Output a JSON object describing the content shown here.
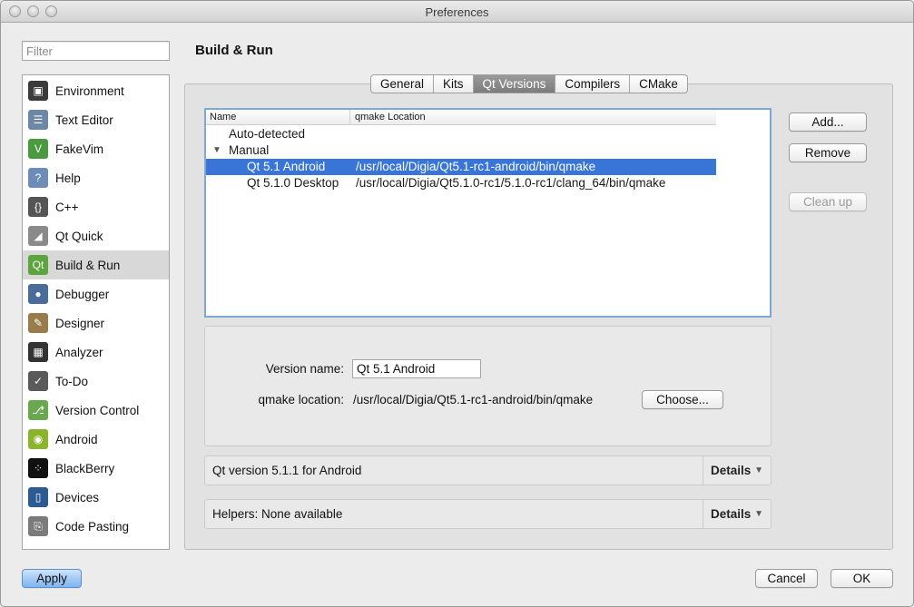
{
  "window": {
    "title": "Preferences"
  },
  "filter": {
    "placeholder": "Filter"
  },
  "sidebar": {
    "items": [
      {
        "label": "Environment",
        "icon": "environment-icon",
        "color": "#3b3b3b"
      },
      {
        "label": "Text Editor",
        "icon": "text-editor-icon",
        "color": "#6d87a6"
      },
      {
        "label": "FakeVim",
        "icon": "fakevim-icon",
        "color": "#4a9a3f"
      },
      {
        "label": "Help",
        "icon": "help-icon",
        "color": "#6e8cb8"
      },
      {
        "label": "C++",
        "icon": "cpp-icon",
        "color": "#555555"
      },
      {
        "label": "Qt Quick",
        "icon": "qt-quick-icon",
        "color": "#8a8a8a"
      },
      {
        "label": "Build & Run",
        "icon": "build-run-icon",
        "color": "#5aa53c"
      },
      {
        "label": "Debugger",
        "icon": "debugger-icon",
        "color": "#4a6c9a"
      },
      {
        "label": "Designer",
        "icon": "designer-icon",
        "color": "#9a7b4a"
      },
      {
        "label": "Analyzer",
        "icon": "analyzer-icon",
        "color": "#333333"
      },
      {
        "label": "To-Do",
        "icon": "todo-icon",
        "color": "#5a5a5a"
      },
      {
        "label": "Version Control",
        "icon": "version-control-icon",
        "color": "#6aa84f"
      },
      {
        "label": "Android",
        "icon": "android-icon",
        "color": "#8ab42c"
      },
      {
        "label": "BlackBerry",
        "icon": "blackberry-icon",
        "color": "#111111"
      },
      {
        "label": "Devices",
        "icon": "devices-icon",
        "color": "#2c5a95"
      },
      {
        "label": "Code Pasting",
        "icon": "code-pasting-icon",
        "color": "#7a7a7a"
      }
    ],
    "selected": "Build & Run"
  },
  "page": {
    "title": "Build & Run"
  },
  "tabs": [
    {
      "label": "General",
      "active": false
    },
    {
      "label": "Kits",
      "active": false
    },
    {
      "label": "Qt Versions",
      "active": true
    },
    {
      "label": "Compilers",
      "active": false
    },
    {
      "label": "CMake",
      "active": false
    }
  ],
  "tree": {
    "columns": [
      "Name",
      "qmake Location"
    ],
    "rows": [
      {
        "name": "Auto-detected",
        "location": "",
        "level": 0,
        "selected": false
      },
      {
        "name": "Manual",
        "location": "",
        "level": 0,
        "expanded": true,
        "selected": false
      },
      {
        "name": "Qt 5.1 Android",
        "location": "/usr/local/Digia/Qt5.1-rc1-android/bin/qmake",
        "level": 1,
        "selected": true
      },
      {
        "name": "Qt 5.1.0 Desktop",
        "location": "/usr/local/Digia/Qt5.1.0-rc1/5.1.0-rc1/clang_64/bin/qmake",
        "level": 1,
        "selected": false
      }
    ]
  },
  "actions": {
    "add": "Add...",
    "remove": "Remove",
    "cleanup": "Clean up"
  },
  "form": {
    "version_name_label": "Version name:",
    "version_name_value": "Qt 5.1 Android",
    "qmake_label": "qmake location:",
    "qmake_value": "/usr/local/Digia/Qt5.1-rc1-android/bin/qmake",
    "choose": "Choose..."
  },
  "sections": [
    {
      "text": "Qt version 5.1.1 for Android",
      "details": "Details"
    },
    {
      "text": "Helpers: None available",
      "details": "Details"
    }
  ],
  "footer": {
    "apply": "Apply",
    "cancel": "Cancel",
    "ok": "OK"
  }
}
